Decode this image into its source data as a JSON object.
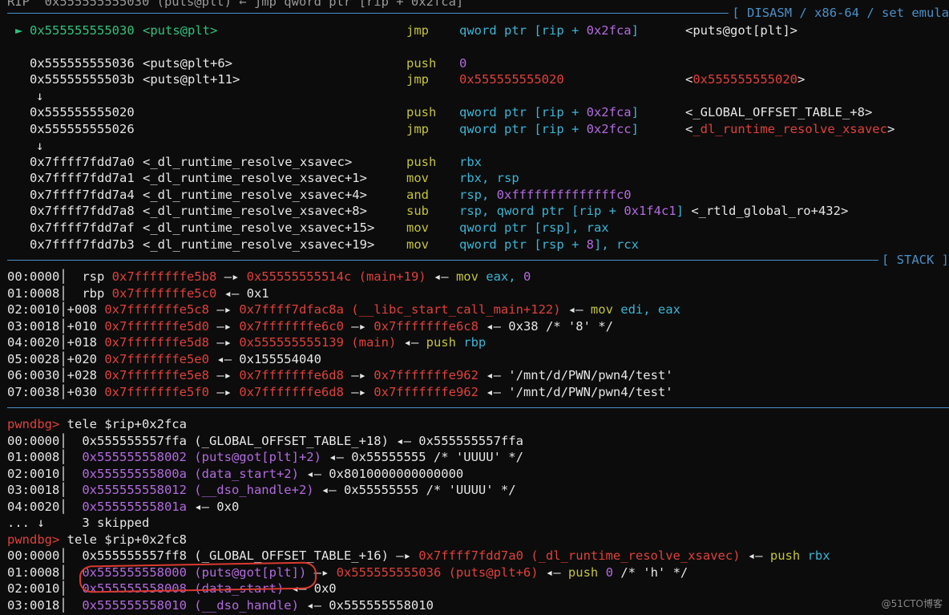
{
  "disasm": {
    "header_line": "RIP  0x555555555030 (puts@plt) ← jmp qword ptr [rip + 0x2fca]",
    "title": "[ DISASM / x86-64 / set emula",
    "current_marker": "►",
    "arrow_down": "↓",
    "lines": [
      {
        "addr": "0x555555555030",
        "sym": "<puts@plt>",
        "mnem": "jmp",
        "ops": [
          {
            "t": "qword ptr [rip + ",
            "c": "cyan"
          },
          {
            "t": "0x2fca",
            "c": "purple"
          },
          {
            "t": "]",
            "c": "cyan"
          }
        ],
        "comment": [
          {
            "t": "<puts@got[plt]>",
            "c": "white"
          }
        ]
      },
      {
        "addr": "0x555555555036",
        "sym": "<puts@plt+6>",
        "mnem": "push",
        "ops": [
          {
            "t": "0",
            "c": "purple"
          }
        ],
        "comment": []
      },
      {
        "addr": "0x55555555503b",
        "sym": "<puts@plt+11>",
        "mnem": "jmp",
        "ops": [
          {
            "t": "0x555555555020",
            "c": "red"
          }
        ],
        "comment": [
          {
            "t": "<",
            "c": "white"
          },
          {
            "t": "0x555555555020",
            "c": "red"
          },
          {
            "t": ">",
            "c": "white"
          }
        ]
      },
      {
        "addr": "0x555555555020",
        "sym": "",
        "mnem": "push",
        "ops": [
          {
            "t": "qword ptr [rip + ",
            "c": "cyan"
          },
          {
            "t": "0x2fca",
            "c": "purple"
          },
          {
            "t": "]",
            "c": "cyan"
          }
        ],
        "comment": [
          {
            "t": "<_GLOBAL_OFFSET_TABLE_+8>",
            "c": "white"
          }
        ]
      },
      {
        "addr": "0x555555555026",
        "sym": "",
        "mnem": "jmp",
        "ops": [
          {
            "t": "qword ptr [rip + ",
            "c": "cyan"
          },
          {
            "t": "0x2fcc",
            "c": "purple"
          },
          {
            "t": "]",
            "c": "cyan"
          }
        ],
        "comment": [
          {
            "t": "<",
            "c": "white"
          },
          {
            "t": "_dl_runtime_resolve_xsavec",
            "c": "red"
          },
          {
            "t": ">",
            "c": "white"
          }
        ]
      },
      {
        "addr": "0x7ffff7fdd7a0",
        "sym": "<_dl_runtime_resolve_xsavec>",
        "mnem": "push",
        "ops": [
          {
            "t": "rbx",
            "c": "cyan"
          }
        ],
        "comment": []
      },
      {
        "addr": "0x7ffff7fdd7a1",
        "sym": "<_dl_runtime_resolve_xsavec+1>",
        "mnem": "mov",
        "ops": [
          {
            "t": "rbx, rsp",
            "c": "cyan"
          }
        ],
        "comment": []
      },
      {
        "addr": "0x7ffff7fdd7a4",
        "sym": "<_dl_runtime_resolve_xsavec+4>",
        "mnem": "and",
        "ops": [
          {
            "t": "rsp, ",
            "c": "cyan"
          },
          {
            "t": "0xffffffffffffffc0",
            "c": "purple"
          }
        ],
        "comment": []
      },
      {
        "addr": "0x7ffff7fdd7a8",
        "sym": "<_dl_runtime_resolve_xsavec+8>",
        "mnem": "sub",
        "ops": [
          {
            "t": "rsp, qword ptr [rip + ",
            "c": "cyan"
          },
          {
            "t": "0x1f4c1",
            "c": "purple"
          },
          {
            "t": "]",
            "c": "cyan"
          },
          {
            "t": " <_rtld_global_ro+432>",
            "c": "white"
          }
        ],
        "comment": []
      },
      {
        "addr": "0x7ffff7fdd7af",
        "sym": "<_dl_runtime_resolve_xsavec+15>",
        "mnem": "mov",
        "ops": [
          {
            "t": "qword ptr [rsp], rax",
            "c": "cyan"
          }
        ],
        "comment": []
      },
      {
        "addr": "0x7ffff7fdd7b3",
        "sym": "<_dl_runtime_resolve_xsavec+19>",
        "mnem": "mov",
        "ops": [
          {
            "t": "qword ptr [rsp + ",
            "c": "cyan"
          },
          {
            "t": "8",
            "c": "purple"
          },
          {
            "t": "], rcx",
            "c": "cyan"
          }
        ],
        "comment": []
      }
    ]
  },
  "stack": {
    "title": "[ STACK ]",
    "rows": [
      [
        {
          "t": "00:0000│  rsp ",
          "c": "white"
        },
        {
          "t": "0x7fffffffe5b8",
          "c": "red"
        },
        {
          "t": " —▸ ",
          "c": "white"
        },
        {
          "t": "0x55555555514c (main+19)",
          "c": "red"
        },
        {
          "t": " ◂— ",
          "c": "white"
        },
        {
          "t": "mov",
          "c": "yellow"
        },
        {
          "t": " eax, ",
          "c": "cyan"
        },
        {
          "t": "0",
          "c": "purple"
        }
      ],
      [
        {
          "t": "01:0008│  rbp ",
          "c": "white"
        },
        {
          "t": "0x7fffffffe5c0",
          "c": "red"
        },
        {
          "t": " ◂— 0x1",
          "c": "white"
        }
      ],
      [
        {
          "t": "02:0010│+008 ",
          "c": "white"
        },
        {
          "t": "0x7fffffffe5c8",
          "c": "red"
        },
        {
          "t": " —▸ ",
          "c": "white"
        },
        {
          "t": "0x7ffff7dfac8a (__libc_start_call_main+122)",
          "c": "red"
        },
        {
          "t": " ◂— ",
          "c": "white"
        },
        {
          "t": "mov",
          "c": "yellow"
        },
        {
          "t": " edi, eax",
          "c": "cyan"
        }
      ],
      [
        {
          "t": "03:0018│+010 ",
          "c": "white"
        },
        {
          "t": "0x7fffffffe5d0",
          "c": "red"
        },
        {
          "t": " —▸ ",
          "c": "white"
        },
        {
          "t": "0x7fffffffe6c0",
          "c": "red"
        },
        {
          "t": " —▸ ",
          "c": "white"
        },
        {
          "t": "0x7fffffffe6c8",
          "c": "red"
        },
        {
          "t": " ◂— 0x38 /* '8' */",
          "c": "white"
        }
      ],
      [
        {
          "t": "04:0020│+018 ",
          "c": "white"
        },
        {
          "t": "0x7fffffffe5d8",
          "c": "red"
        },
        {
          "t": " —▸ ",
          "c": "white"
        },
        {
          "t": "0x555555555139 (main)",
          "c": "red"
        },
        {
          "t": " ◂— ",
          "c": "white"
        },
        {
          "t": "push",
          "c": "yellow"
        },
        {
          "t": " rbp",
          "c": "cyan"
        }
      ],
      [
        {
          "t": "05:0028│+020 ",
          "c": "white"
        },
        {
          "t": "0x7fffffffe5e0",
          "c": "red"
        },
        {
          "t": " ◂— 0x155554040",
          "c": "white"
        }
      ],
      [
        {
          "t": "06:0030│+028 ",
          "c": "white"
        },
        {
          "t": "0x7fffffffe5e8",
          "c": "red"
        },
        {
          "t": " —▸ ",
          "c": "white"
        },
        {
          "t": "0x7fffffffe6d8",
          "c": "red"
        },
        {
          "t": " —▸ ",
          "c": "white"
        },
        {
          "t": "0x7fffffffe962",
          "c": "red"
        },
        {
          "t": " ◂— '/mnt/d/PWN/pwn4/test'",
          "c": "white"
        }
      ],
      [
        {
          "t": "07:0038│+030 ",
          "c": "white"
        },
        {
          "t": "0x7fffffffe5f0",
          "c": "red"
        },
        {
          "t": " —▸ ",
          "c": "white"
        },
        {
          "t": "0x7fffffffe6d8",
          "c": "red"
        },
        {
          "t": " —▸ ",
          "c": "white"
        },
        {
          "t": "0x7fffffffe962",
          "c": "red"
        },
        {
          "t": " ◂— '/mnt/d/PWN/pwn4/test'",
          "c": "white"
        }
      ]
    ]
  },
  "console": {
    "prompt": "pwndbg>",
    "rows": [
      [
        {
          "t": "pwndbg>",
          "c": "red"
        },
        {
          "t": " tele $rip+0x2fca",
          "c": "white"
        }
      ],
      [
        {
          "t": "00:0000│  ",
          "c": "white"
        },
        {
          "t": "0x555555557ffa (_GLOBAL_OFFSET_TABLE_+18) ◂— 0x555555557ffa",
          "c": "white"
        }
      ],
      [
        {
          "t": "01:0008│  ",
          "c": "white"
        },
        {
          "t": "0x555555558002 (puts@got[plt]+2)",
          "c": "purple"
        },
        {
          "t": " ◂— 0x55555555 /* 'UUUU' */",
          "c": "white"
        }
      ],
      [
        {
          "t": "02:0010│  ",
          "c": "white"
        },
        {
          "t": "0x55555555800a (data_start+2)",
          "c": "purple"
        },
        {
          "t": " ◂— 0x8010000000000000",
          "c": "white"
        }
      ],
      [
        {
          "t": "03:0018│  ",
          "c": "white"
        },
        {
          "t": "0x555555558012 (__dso_handle+2)",
          "c": "purple"
        },
        {
          "t": " ◂— 0x55555555 /* 'UUUU' */",
          "c": "white"
        }
      ],
      [
        {
          "t": "04:0020│  ",
          "c": "white"
        },
        {
          "t": "0x55555555801a",
          "c": "purple"
        },
        {
          "t": " ◂— 0x0",
          "c": "white"
        }
      ],
      [
        {
          "t": "... ↓     3 skipped",
          "c": "white"
        }
      ],
      [
        {
          "t": "pwndbg>",
          "c": "red"
        },
        {
          "t": " tele $rip+0x2fc8",
          "c": "white"
        }
      ],
      [
        {
          "t": "00:0000│  ",
          "c": "white"
        },
        {
          "t": "0x555555557ff8 (_GLOBAL_OFFSET_TABLE_+16) —▸ ",
          "c": "white"
        },
        {
          "t": "0x7ffff7fdd7a0 (_dl_runtime_resolve_xsavec)",
          "c": "red"
        },
        {
          "t": " ◂— ",
          "c": "white"
        },
        {
          "t": "push",
          "c": "yellow"
        },
        {
          "t": " rbx",
          "c": "cyan"
        }
      ],
      [
        {
          "t": "01:0008│  ",
          "c": "white"
        },
        {
          "t": "0x555555558000 (puts@got[plt])",
          "c": "purple"
        },
        {
          "t": " —▸ ",
          "c": "white"
        },
        {
          "t": "0x555555555036 (puts@plt+6)",
          "c": "red"
        },
        {
          "t": " ◂— ",
          "c": "white"
        },
        {
          "t": "push",
          "c": "yellow"
        },
        {
          "t": " 0",
          "c": "purple"
        },
        {
          "t": " /* 'h' */",
          "c": "white"
        }
      ],
      [
        {
          "t": "02:0010│  ",
          "c": "white"
        },
        {
          "t": "0x555555558008 (data_start)",
          "c": "purple"
        },
        {
          "t": " ◂— 0x0",
          "c": "white"
        }
      ],
      [
        {
          "t": "03:0018│  ",
          "c": "white"
        },
        {
          "t": "0x555555558010 (__dso_handle)",
          "c": "purple"
        },
        {
          "t": " ◂— 0x555555558010",
          "c": "white"
        }
      ]
    ]
  },
  "watermark": "@51CTO博客"
}
